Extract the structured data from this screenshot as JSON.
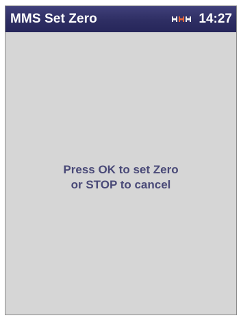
{
  "header": {
    "title": "MMS Set Zero",
    "time": "14:27",
    "status_icon": "battery-icon"
  },
  "message": {
    "line1": "Press OK to set Zero",
    "line2": "or STOP to cancel"
  },
  "colors": {
    "titlebar": "#2e2e63",
    "background": "#d6d6d6",
    "message_text": "#4a4a78",
    "battery_accent": "#e0643c"
  }
}
